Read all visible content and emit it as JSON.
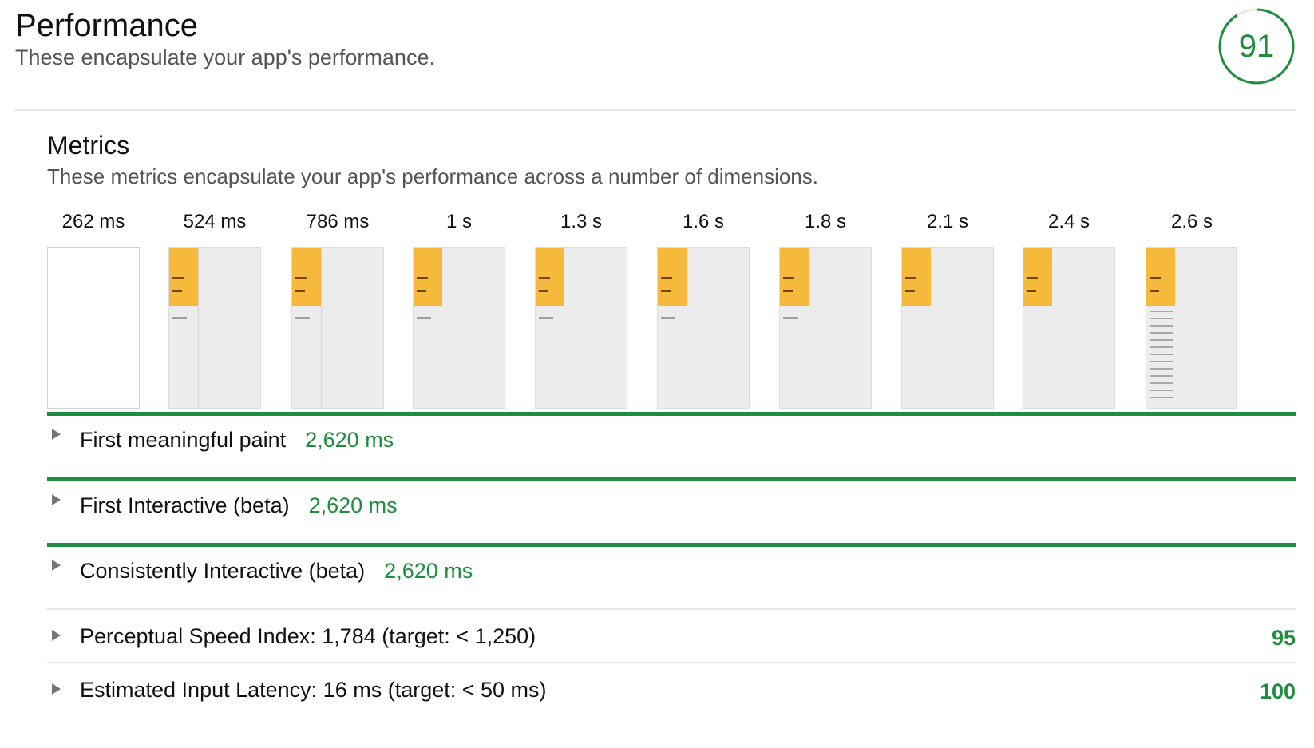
{
  "header": {
    "title": "Performance",
    "subtitle": "These encapsulate your app's performance.",
    "score": "91",
    "score_color": "#1e8e3e",
    "score_fraction": 0.91
  },
  "metrics": {
    "title": "Metrics",
    "description": "These metrics encapsulate your app's performance across a number of dimensions."
  },
  "filmstrip": {
    "frames": [
      {
        "time": "262 ms",
        "state": "blank"
      },
      {
        "time": "524 ms",
        "state": "partial"
      },
      {
        "time": "786 ms",
        "state": "partial"
      },
      {
        "time": "1 s",
        "state": "partial"
      },
      {
        "time": "1.3 s",
        "state": "partial"
      },
      {
        "time": "1.6 s",
        "state": "partial"
      },
      {
        "time": "1.8 s",
        "state": "partial"
      },
      {
        "time": "2.1 s",
        "state": "block-only"
      },
      {
        "time": "2.4 s",
        "state": "block-only"
      },
      {
        "time": "2.6 s",
        "state": "complete"
      }
    ]
  },
  "metric_rows": [
    {
      "label": "First meaningful paint",
      "value": "2,620 ms",
      "score": ""
    },
    {
      "label": "First Interactive (beta)",
      "value": "2,620 ms",
      "score": ""
    },
    {
      "label": "Consistently Interactive (beta)",
      "value": "2,620 ms",
      "score": ""
    },
    {
      "label": "Perceptual Speed Index: 1,784 (target: < 1,250)",
      "value": "",
      "score": "95"
    },
    {
      "label": "Estimated Input Latency: 16 ms (target: < 50 ms)",
      "value": "",
      "score": "100"
    }
  ],
  "colors": {
    "pass": "#1e8e3e",
    "thumb_accent": "#f6b93b"
  }
}
